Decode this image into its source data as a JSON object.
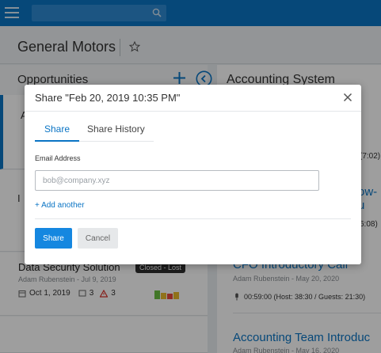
{
  "topbar": {
    "menu_icon": "hamburger-icon",
    "search_icon": "search-icon",
    "color": "#0a74c4"
  },
  "header": {
    "company": "General Motors",
    "favorite_icon": "star-icon"
  },
  "opportunities": {
    "title": "Opportunities",
    "add_icon": "plus-icon",
    "collapse_icon": "chevron-left-icon",
    "cards": [
      {
        "title_peek": "A"
      },
      {
        "title_peek": "I"
      },
      {
        "title": "Data Security Solution",
        "badge": "Closed - Lost",
        "subtitle": "Adam Rubenstein - Jul 9, 2019",
        "date": "Oct 1, 2019",
        "notes_count": "3",
        "alerts_count": "3",
        "bar_colors": [
          "#6abf40",
          "#e8b82a",
          "#e84a3c",
          "#e8b82a"
        ]
      }
    ]
  },
  "detail": {
    "title": "Accounting System",
    "peeks": [
      "(7:02)",
      "ow-u",
      "6:08)"
    ],
    "meetings": [
      {
        "title": "CFO Introductory Call",
        "subtitle": "Adam Rubenstein - May 20, 2020",
        "duration": "00:59:00 (Host: 38:30 / Guests: 21:30)"
      },
      {
        "title": "Accounting Team Introduc",
        "subtitle": "Adam Rubenstein - May 16, 2020"
      }
    ]
  },
  "modal": {
    "title": "Share \"Feb 20, 2019 10:35 PM\"",
    "tabs": [
      "Share",
      "Share History"
    ],
    "active_tab": "Share",
    "email_label": "Email Address",
    "email_placeholder": "bob@company.xyz",
    "add_another": "+ Add another",
    "share_button": "Share",
    "cancel_button": "Cancel"
  }
}
